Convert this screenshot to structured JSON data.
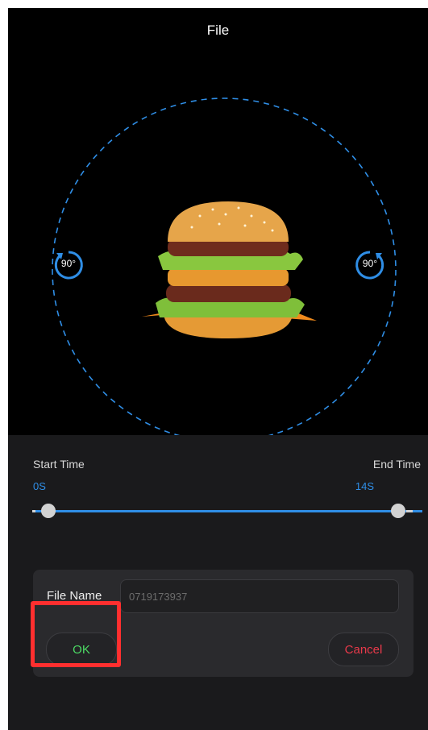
{
  "header": {
    "title": "File"
  },
  "viewer": {
    "rotate_left_label": "90°",
    "rotate_right_label": "90°",
    "accent_color": "#2f8ee6"
  },
  "trim": {
    "start_label": "Start Time",
    "start_value": "0S",
    "end_label": "End Time",
    "end_value": "14S"
  },
  "dialog": {
    "file_name_label": "File Name",
    "file_name_placeholder": "0719173937",
    "ok_label": "OK",
    "cancel_label": "Cancel"
  },
  "icons": [
    "rotate-left-icon",
    "rotate-right-icon"
  ],
  "colors": {
    "ok": "#4cd964",
    "cancel": "#e8394a",
    "highlight": "#ff2f2f"
  }
}
